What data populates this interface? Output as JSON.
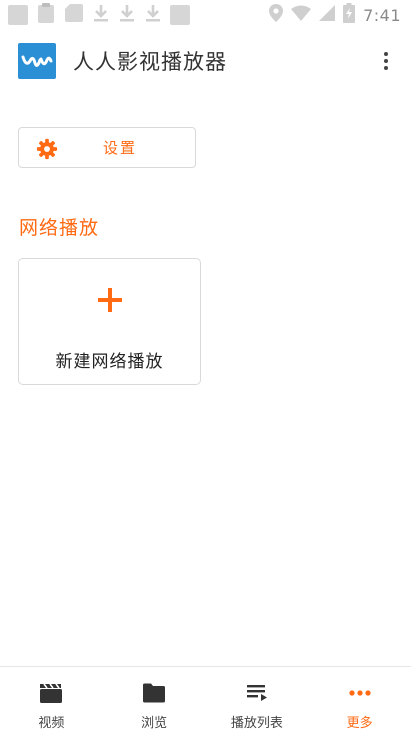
{
  "status_bar": {
    "time": "7:41"
  },
  "app_bar": {
    "title": "人人影视播放器"
  },
  "settings": {
    "label": "设置"
  },
  "network_section": {
    "title": "网络播放",
    "new_card_label": "新建网络播放"
  },
  "bottom_nav": {
    "items": [
      {
        "label": "视频",
        "icon": "clapperboard-icon"
      },
      {
        "label": "浏览",
        "icon": "folder-icon"
      },
      {
        "label": "播放列表",
        "icon": "playlist-icon"
      },
      {
        "label": "更多",
        "icon": "more-dots-icon"
      }
    ],
    "active_index": 3
  },
  "colors": {
    "accent": "#ff6a13",
    "logo_blue": "#2b8fd6",
    "icon_dark": "#333333",
    "border": "#d9d9d9"
  }
}
